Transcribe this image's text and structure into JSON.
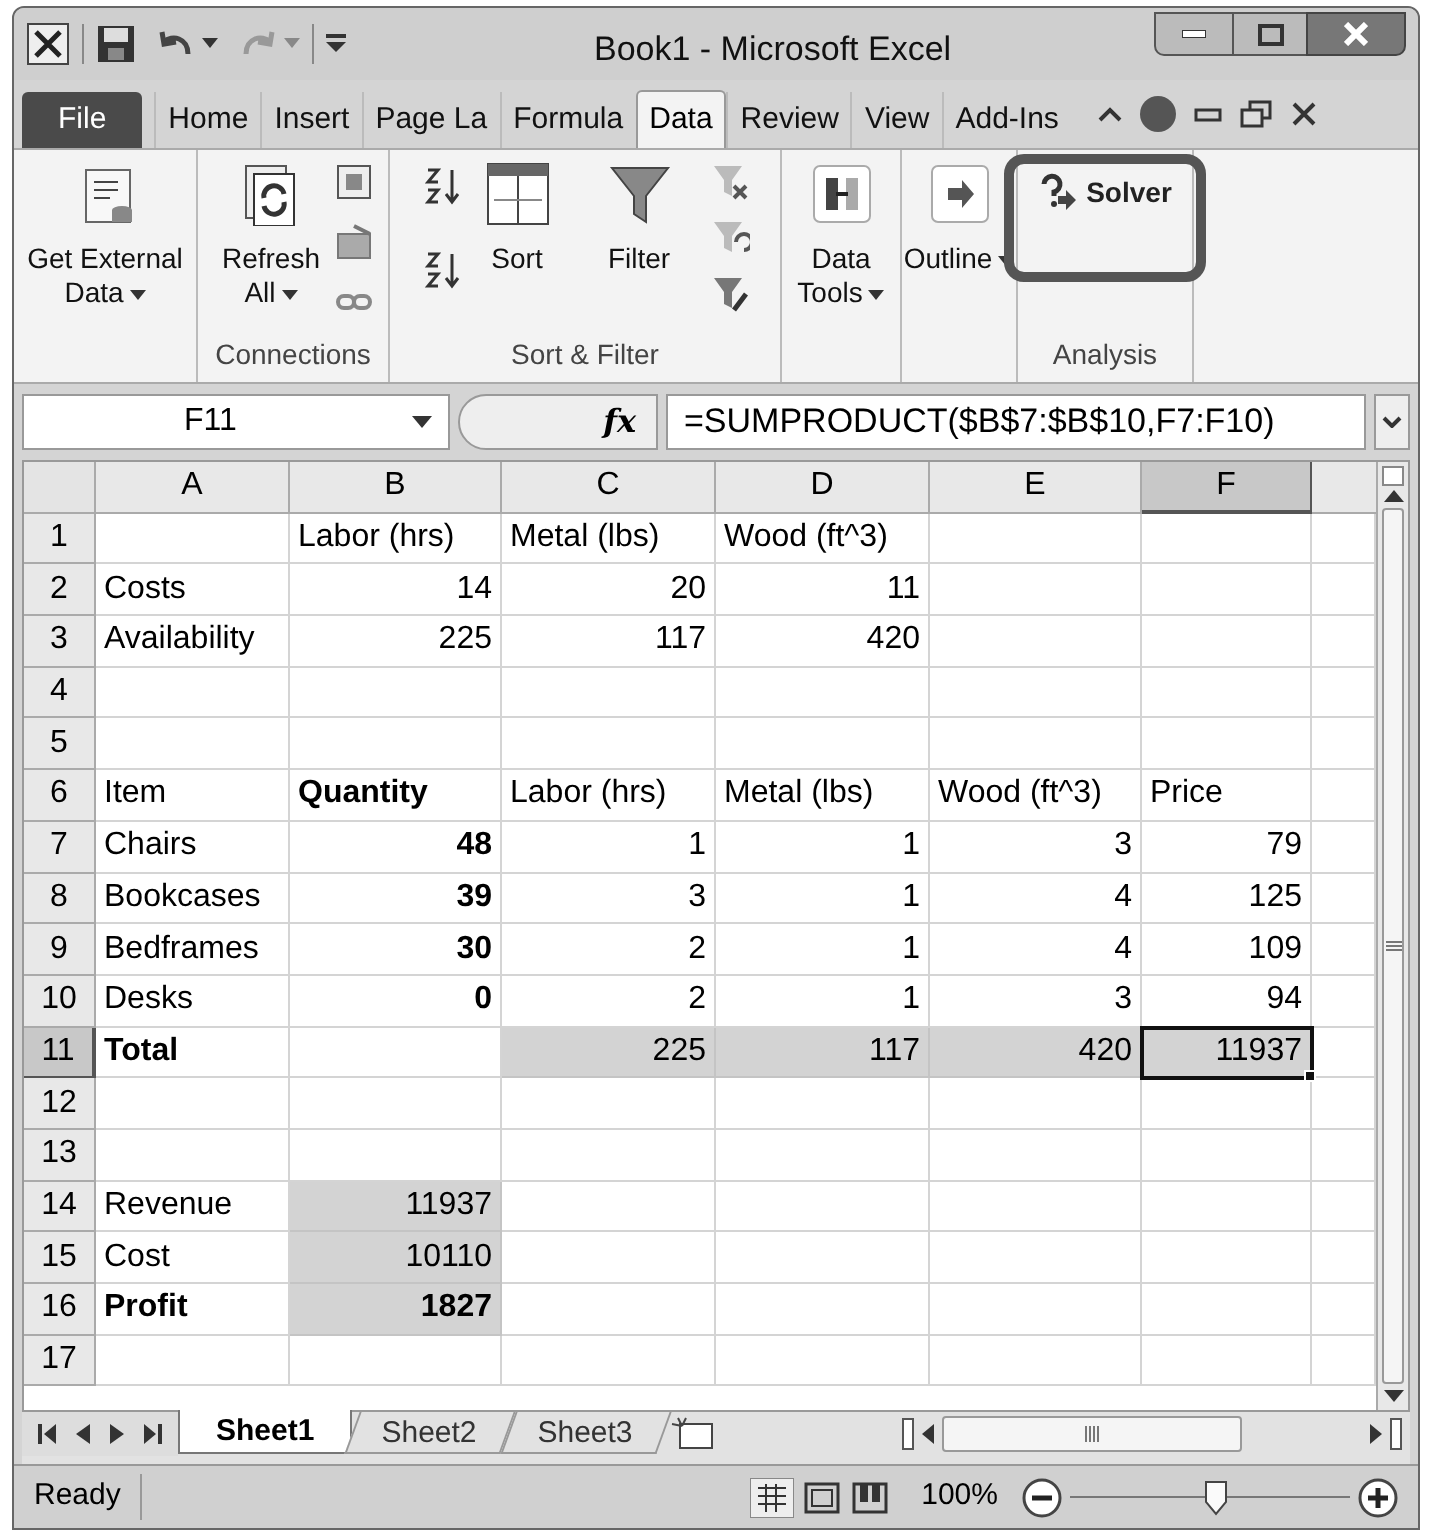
{
  "window": {
    "title": "Book1  -  Microsoft Excel"
  },
  "ribbon_tabs": [
    {
      "label": "File",
      "kind": "file",
      "selected": false
    },
    {
      "label": "Home",
      "kind": "tab",
      "selected": false
    },
    {
      "label": "Insert",
      "kind": "tab",
      "selected": false
    },
    {
      "label": "Page La",
      "kind": "tab",
      "selected": false
    },
    {
      "label": "Formula",
      "kind": "tab",
      "selected": false
    },
    {
      "label": "Data",
      "kind": "tab",
      "selected": true
    },
    {
      "label": "Review",
      "kind": "tab",
      "selected": false
    },
    {
      "label": "View",
      "kind": "tab",
      "selected": false
    },
    {
      "label": "Add-Ins",
      "kind": "tab",
      "selected": false
    }
  ],
  "ribbon": {
    "groups": [
      {
        "buttons": [
          {
            "label": "Get External Data",
            "dropdown": true,
            "highlighted": false
          }
        ]
      },
      {
        "label": "Connections",
        "buttons": [
          {
            "label": "Refresh All",
            "dropdown": true,
            "highlighted": false
          }
        ]
      },
      {
        "label": "Sort & Filter",
        "buttons": [
          {
            "label": "Sort",
            "dropdown": false,
            "highlighted": false
          },
          {
            "label": "Filter",
            "dropdown": false,
            "highlighted": false
          }
        ]
      },
      {
        "buttons": [
          {
            "label": "Data Tools",
            "dropdown": true,
            "highlighted": false
          }
        ]
      },
      {
        "buttons": [
          {
            "label": "Outline",
            "dropdown": true,
            "highlighted": false
          }
        ]
      },
      {
        "label": "Analysis",
        "buttons": [
          {
            "label": "Solver",
            "dropdown": false,
            "highlighted": true
          }
        ]
      }
    ]
  },
  "formula_bar": {
    "name_box": "F11",
    "fx": "fx",
    "formula": "=SUMPRODUCT($B$7:$B$10,F7:F10)"
  },
  "sheet": {
    "columns": [
      {
        "label": "A",
        "selected": false
      },
      {
        "label": "B",
        "selected": false
      },
      {
        "label": "C",
        "selected": false
      },
      {
        "label": "D",
        "selected": false
      },
      {
        "label": "E",
        "selected": false
      },
      {
        "label": "F",
        "selected": true
      }
    ],
    "rows": [
      {
        "number": "1",
        "selected": false,
        "cells": [
          null,
          {
            "text": "Labor (hrs)",
            "kind": "label",
            "bold": false,
            "shaded": false,
            "selected": false
          },
          {
            "text": "Metal (lbs)",
            "kind": "label",
            "bold": false,
            "shaded": false,
            "selected": false
          },
          {
            "text": "Wood (ft^3)",
            "kind": "label",
            "bold": false,
            "shaded": false,
            "selected": false
          },
          null,
          null
        ]
      },
      {
        "number": "2",
        "selected": false,
        "cells": [
          {
            "text": "Costs",
            "kind": "label",
            "bold": false,
            "shaded": false,
            "selected": false
          },
          {
            "text": "14",
            "kind": "number",
            "bold": false,
            "shaded": false,
            "selected": false
          },
          {
            "text": "20",
            "kind": "number",
            "bold": false,
            "shaded": false,
            "selected": false
          },
          {
            "text": "11",
            "kind": "number",
            "bold": false,
            "shaded": false,
            "selected": false
          },
          null,
          null
        ]
      },
      {
        "number": "3",
        "selected": false,
        "cells": [
          {
            "text": "Availability",
            "kind": "label",
            "bold": false,
            "shaded": false,
            "selected": false
          },
          {
            "text": "225",
            "kind": "number",
            "bold": false,
            "shaded": false,
            "selected": false
          },
          {
            "text": "117",
            "kind": "number",
            "bold": false,
            "shaded": false,
            "selected": false
          },
          {
            "text": "420",
            "kind": "number",
            "bold": false,
            "shaded": false,
            "selected": false
          },
          null,
          null
        ]
      },
      {
        "number": "4",
        "selected": false
      },
      {
        "number": "5",
        "selected": false
      },
      {
        "number": "6",
        "selected": false,
        "cells": [
          {
            "text": "Item",
            "kind": "label",
            "bold": false,
            "shaded": false,
            "selected": false
          },
          {
            "text": "Quantity",
            "kind": "label",
            "bold": true,
            "shaded": false,
            "selected": false
          },
          {
            "text": "Labor (hrs)",
            "kind": "label",
            "bold": false,
            "shaded": false,
            "selected": false
          },
          {
            "text": "Metal (lbs)",
            "kind": "label",
            "bold": false,
            "shaded": false,
            "selected": false
          },
          {
            "text": "Wood (ft^3)",
            "kind": "label",
            "bold": false,
            "shaded": false,
            "selected": false
          },
          {
            "text": "Price",
            "kind": "label",
            "bold": false,
            "shaded": false,
            "selected": false
          }
        ]
      },
      {
        "number": "7",
        "selected": false,
        "cells": [
          {
            "text": "Chairs",
            "kind": "label",
            "bold": false,
            "shaded": false,
            "selected": false
          },
          {
            "text": "48",
            "kind": "number",
            "bold": true,
            "shaded": false,
            "selected": false
          },
          {
            "text": "1",
            "kind": "number",
            "bold": false,
            "shaded": false,
            "selected": false
          },
          {
            "text": "1",
            "kind": "number",
            "bold": false,
            "shaded": false,
            "selected": false
          },
          {
            "text": "3",
            "kind": "number",
            "bold": false,
            "shaded": false,
            "selected": false
          },
          {
            "text": "79",
            "kind": "number",
            "bold": false,
            "shaded": false,
            "selected": false
          }
        ]
      },
      {
        "number": "8",
        "selected": false,
        "cells": [
          {
            "text": "Bookcases",
            "kind": "label",
            "bold": false,
            "shaded": false,
            "selected": false
          },
          {
            "text": "39",
            "kind": "number",
            "bold": true,
            "shaded": false,
            "selected": false
          },
          {
            "text": "3",
            "kind": "number",
            "bold": false,
            "shaded": false,
            "selected": false
          },
          {
            "text": "1",
            "kind": "number",
            "bold": false,
            "shaded": false,
            "selected": false
          },
          {
            "text": "4",
            "kind": "number",
            "bold": false,
            "shaded": false,
            "selected": false
          },
          {
            "text": "125",
            "kind": "number",
            "bold": false,
            "shaded": false,
            "selected": false
          }
        ]
      },
      {
        "number": "9",
        "selected": false,
        "cells": [
          {
            "text": "Bedframes",
            "kind": "label",
            "bold": false,
            "shaded": false,
            "selected": false
          },
          {
            "text": "30",
            "kind": "number",
            "bold": true,
            "shaded": false,
            "selected": false
          },
          {
            "text": "2",
            "kind": "number",
            "bold": false,
            "shaded": false,
            "selected": false
          },
          {
            "text": "1",
            "kind": "number",
            "bold": false,
            "shaded": false,
            "selected": false
          },
          {
            "text": "4",
            "kind": "number",
            "bold": false,
            "shaded": false,
            "selected": false
          },
          {
            "text": "109",
            "kind": "number",
            "bold": false,
            "shaded": false,
            "selected": false
          }
        ]
      },
      {
        "number": "10",
        "selected": false,
        "cells": [
          {
            "text": "Desks",
            "kind": "label",
            "bold": false,
            "shaded": false,
            "selected": false
          },
          {
            "text": "0",
            "kind": "number",
            "bold": true,
            "shaded": false,
            "selected": false
          },
          {
            "text": "2",
            "kind": "number",
            "bold": false,
            "shaded": false,
            "selected": false
          },
          {
            "text": "1",
            "kind": "number",
            "bold": false,
            "shaded": false,
            "selected": false
          },
          {
            "text": "3",
            "kind": "number",
            "bold": false,
            "shaded": false,
            "selected": false
          },
          {
            "text": "94",
            "kind": "number",
            "bold": false,
            "shaded": false,
            "selected": false
          }
        ]
      },
      {
        "number": "11",
        "selected": true,
        "cells": [
          {
            "text": "Total",
            "kind": "label",
            "bold": true,
            "shaded": false,
            "selected": false
          },
          null,
          {
            "text": "225",
            "kind": "number",
            "bold": false,
            "shaded": true,
            "selected": false
          },
          {
            "text": "117",
            "kind": "number",
            "bold": false,
            "shaded": true,
            "selected": false
          },
          {
            "text": "420",
            "kind": "number",
            "bold": false,
            "shaded": true,
            "selected": false
          },
          {
            "text": "11937",
            "kind": "number",
            "bold": false,
            "shaded": true,
            "selected": true
          }
        ]
      },
      {
        "number": "12",
        "selected": false
      },
      {
        "number": "13",
        "selected": false
      },
      {
        "number": "14",
        "selected": false,
        "cells": [
          {
            "text": "Revenue",
            "kind": "label",
            "bold": false,
            "shaded": false,
            "selected": false
          },
          {
            "text": "11937",
            "kind": "number",
            "bold": false,
            "shaded": true,
            "selected": false
          },
          null,
          null,
          null,
          null
        ]
      },
      {
        "number": "15",
        "selected": false,
        "cells": [
          {
            "text": "Cost",
            "kind": "label",
            "bold": false,
            "shaded": false,
            "selected": false
          },
          {
            "text": "10110",
            "kind": "number",
            "bold": false,
            "shaded": true,
            "selected": false
          },
          null,
          null,
          null,
          null
        ]
      },
      {
        "number": "16",
        "selected": false,
        "cells": [
          {
            "text": "Profit",
            "kind": "label",
            "bold": true,
            "shaded": false,
            "selected": false
          },
          {
            "text": "1827",
            "kind": "number",
            "bold": true,
            "shaded": true,
            "selected": false
          },
          null,
          null,
          null,
          null
        ]
      },
      {
        "number": "17",
        "selected": false
      }
    ]
  },
  "sheet_tabs": [
    {
      "label": "Sheet1",
      "selected": true
    },
    {
      "label": "Sheet2",
      "selected": false
    },
    {
      "label": "Sheet3",
      "selected": false
    }
  ],
  "status_bar": {
    "status": "Ready",
    "zoom": "100%",
    "zoom_level": {
      "level": 0.52
    }
  }
}
